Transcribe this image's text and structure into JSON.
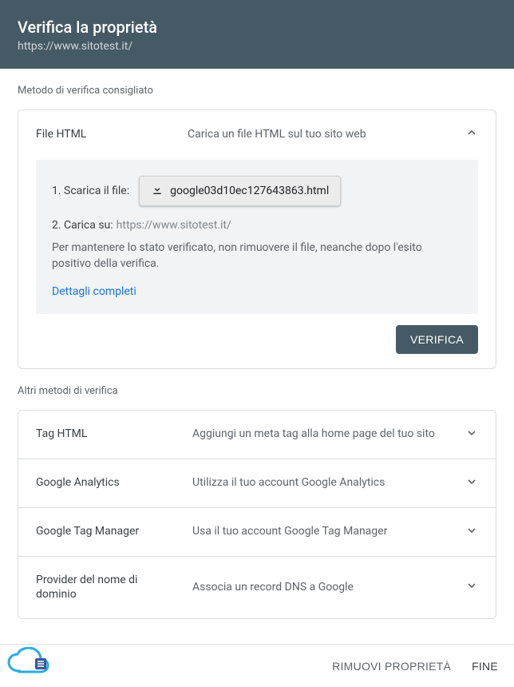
{
  "header": {
    "title": "Verifica la proprietà",
    "url": "https://www.sitotest.it/"
  },
  "sections": {
    "recommended_label": "Metodo di verifica consigliato",
    "other_label": "Altri metodi di verifica"
  },
  "recommended": {
    "name": "File HTML",
    "desc": "Carica un file HTML sul tuo sito web",
    "step1_label": "1. Scarica il file:",
    "download_filename": "google03d10ec127643863.html",
    "step2_label": "2. Carica su:",
    "step2_url": "https://www.sitotest.it/",
    "note": "Per mantenere lo stato verificato, non rimuovere il file, neanche dopo l'esito positivo della verifica.",
    "details_link": "Dettagli completi",
    "verify_button": "VERIFICA"
  },
  "other_methods": [
    {
      "name": "Tag HTML",
      "desc": "Aggiungi un meta tag alla home page del tuo sito"
    },
    {
      "name": "Google Analytics",
      "desc": "Utilizza il tuo account Google Analytics"
    },
    {
      "name": "Google Tag Manager",
      "desc": "Usa il tuo account Google Tag Manager"
    },
    {
      "name": "Provider del nome di dominio",
      "desc": "Associa un record DNS a Google"
    }
  ],
  "footer": {
    "remove": "RIMUOVI PROPRIETÀ",
    "done": "FINE"
  }
}
